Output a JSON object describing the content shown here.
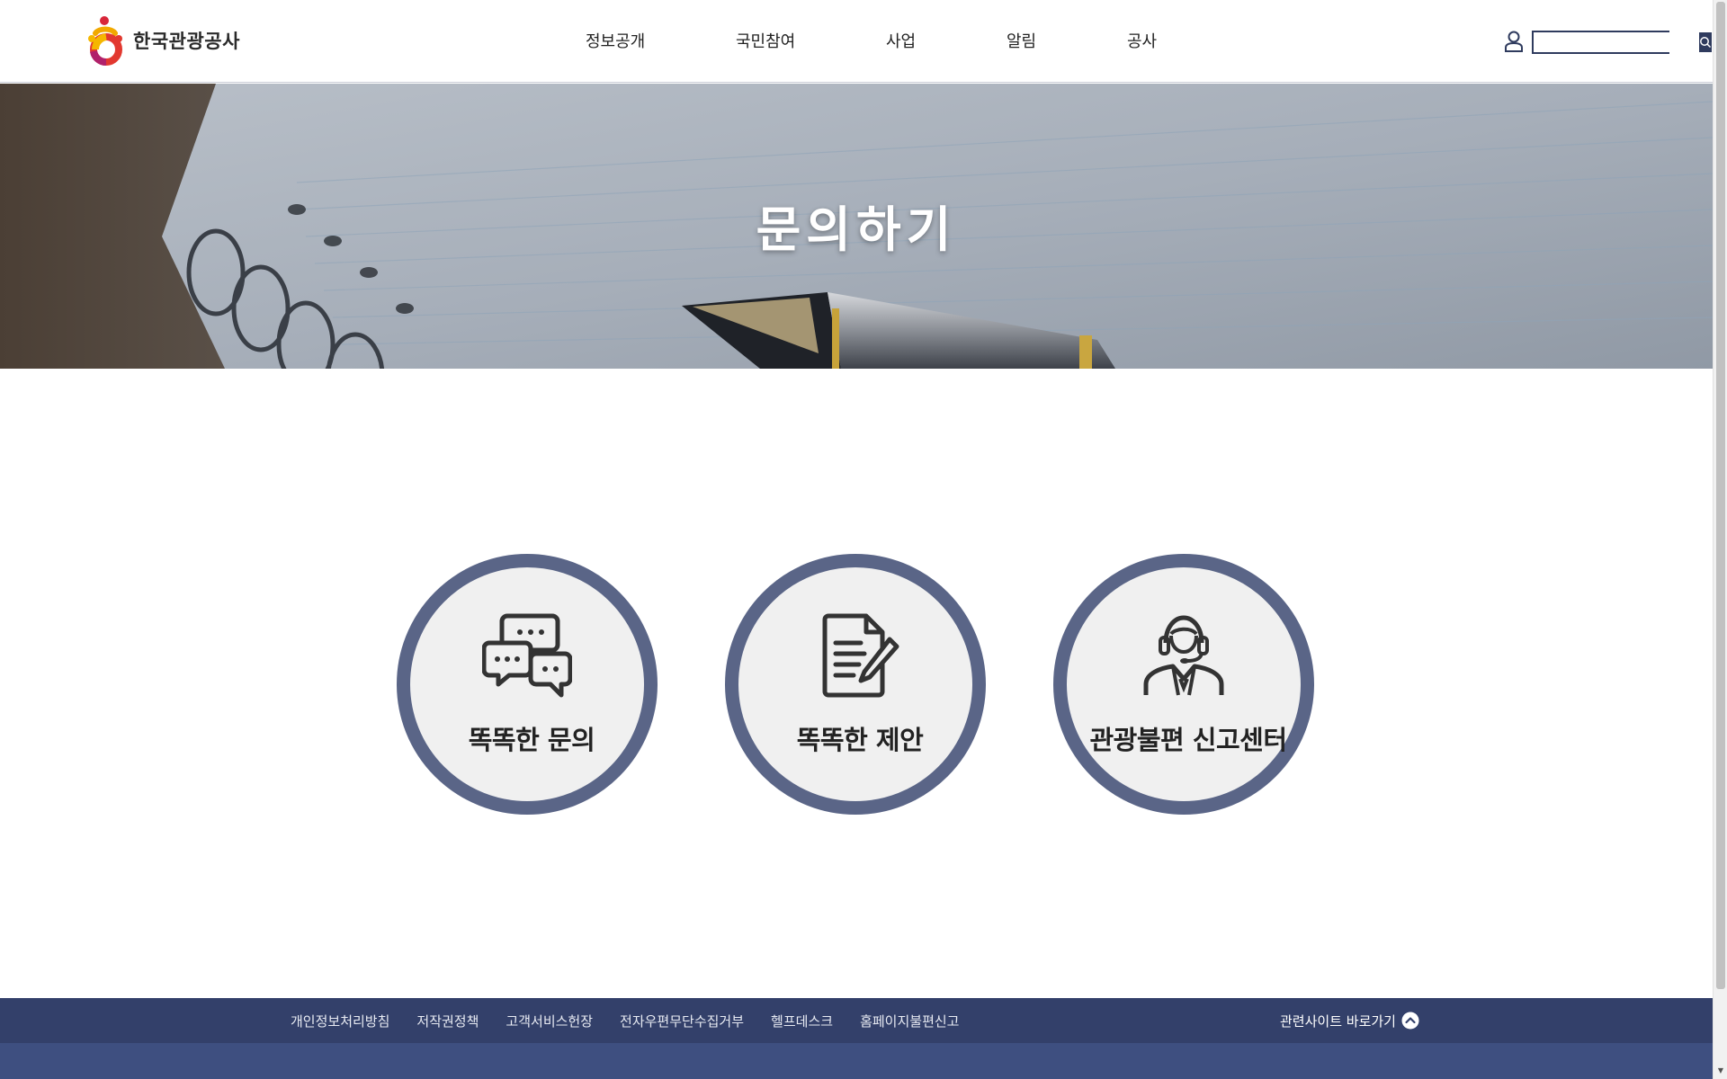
{
  "header": {
    "logo_text": "한국관광공사",
    "nav": [
      {
        "label": "정보공개"
      },
      {
        "label": "국민참여"
      },
      {
        "label": "사업"
      },
      {
        "label": "알림"
      },
      {
        "label": "공사"
      }
    ],
    "search": {
      "value": "",
      "placeholder": ""
    }
  },
  "hero": {
    "title": "문의하기"
  },
  "cards": [
    {
      "label": "똑똑한 문의",
      "icon": "chat-bubbles-icon"
    },
    {
      "label": "똑똑한 제안",
      "icon": "document-pen-icon"
    },
    {
      "label": "관광불편 신고센터",
      "icon": "headset-agent-icon"
    }
  ],
  "footer": {
    "links": [
      {
        "label": "개인정보처리방침"
      },
      {
        "label": "저작권정책"
      },
      {
        "label": "고객서비스헌장"
      },
      {
        "label": "전자우편무단수집거부"
      },
      {
        "label": "헬프데스크"
      },
      {
        "label": "홈페이지불편신고"
      }
    ],
    "related_sites": "관련사이트 바로가기"
  },
  "colors": {
    "primary_navy": "#33406a",
    "footer_bottom": "#3e4f80",
    "card_ring": "#5a6587",
    "card_fill": "#f0f0f0"
  }
}
